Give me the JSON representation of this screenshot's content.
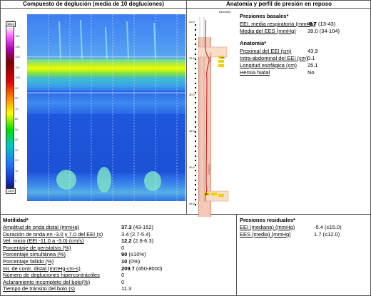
{
  "headers": {
    "left": "Compuesto de deglución (media de 10 degluciones)",
    "right": "Anatomía y perfil de presión en reposo"
  },
  "colorbar": {
    "unit": "mmHg",
    "top": "150.0",
    "bottom": "-10.0",
    "ticks": [
      "140",
      "130",
      "120",
      "110",
      "100",
      "90",
      "80",
      "70",
      "60",
      "50",
      "40",
      "30",
      "20",
      "10",
      "0"
    ]
  },
  "anatomy_scale": {
    "top_label": "EE24425",
    "depths": [
      "20.0",
      "25.0",
      "30.0",
      "35.0",
      "40.0",
      "45.0"
    ],
    "labels": [
      "Faringe",
      "EES",
      "Esófago",
      "EEI"
    ]
  },
  "presiones_basales": {
    "title": "Presiones basales*",
    "rows": [
      {
        "label": "EEI, media respiratoria (mmHg)",
        "value_bold": "-8.7",
        "value": " (13-43)"
      },
      {
        "label": "Media del EES (mmHg)",
        "value_bold": "",
        "value": "39.0 (34-104)"
      }
    ]
  },
  "anatomia": {
    "title": "Anatomía*",
    "rows": [
      {
        "label": "Proximal del EEI (cm)",
        "value": "43.9"
      },
      {
        "label": "Intra-abdominal del EEI (cm)",
        "value": "0.1"
      },
      {
        "label": "Longitud esofágica (cm)",
        "value": "25.1"
      },
      {
        "label": "Hernia hiatal",
        "value": "No"
      }
    ]
  },
  "motilidad": {
    "title": "Motilidad*",
    "rows": [
      {
        "label": "Amplitud de onda distal (mmHg)",
        "value_bold": "37.3",
        "value": " (43-152)"
      },
      {
        "label": "Duración de onda en -3.0 y 7.0 del EEI (s)",
        "value_bold": "",
        "value": "3.4 (2.7-5.4)"
      },
      {
        "label": "Vel. inicio (EEI -11.0 a -3.0) (cm/s)",
        "value_bold": "12.2",
        "value": " (2.8-6.3)"
      },
      {
        "label": "Porcentaje de peristalsis (%)",
        "value_bold": "",
        "value": "0"
      },
      {
        "label": "Porcentaje simultánea (%)",
        "value_bold": "90",
        "value": " (≤10%)"
      },
      {
        "label": "Porcentaje fallido (%)",
        "value_bold": "10",
        "value": " (0%)"
      },
      {
        "label": "Int. de contr. distal (mmHg-cm-s)",
        "value_bold": "209.7",
        "value": " (450-8000)"
      },
      {
        "label": "Número de degluciones hipercontráctiles",
        "value_bold": "",
        "value": "0"
      },
      {
        "label": "Aclaramiento incompleto del bolo(%)",
        "value_bold": "",
        "value": "0"
      },
      {
        "label": "Tiempo de tránsito del bolo (s)",
        "value_bold": "",
        "value": "11.3"
      }
    ]
  },
  "presiones_residuales": {
    "title": "Presiones residuales*",
    "rows": [
      {
        "label": "EEI (mediana) (mmHg)",
        "value": "-5.4 (≤15.0)"
      },
      {
        "label": "EES (media) (mmHg)",
        "value": "1.7 (≤12.0)"
      }
    ]
  }
}
